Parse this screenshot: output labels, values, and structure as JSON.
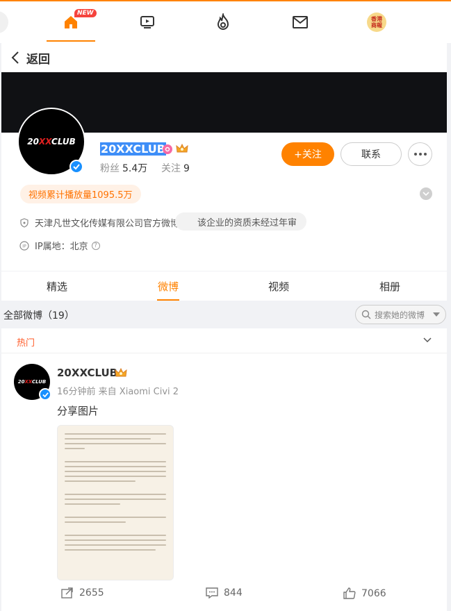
{
  "topnav": {
    "new_badge": "NEW",
    "avatar_text": "香港\n商報",
    "icons": [
      "home-icon",
      "video-icon",
      "fire-icon",
      "mail-icon",
      "avatar"
    ]
  },
  "backbar": {
    "label": "返回"
  },
  "profile": {
    "name": "20XXCLUB",
    "followers_label": "粉丝",
    "followers": "5.4万",
    "following_label": "关注",
    "following": "9",
    "follow_button": "+关注",
    "contact_button": "联系",
    "play_count": "视频累计播放量1095.5万",
    "company": "天津凡世文化传媒有限公司官方微博",
    "qualification": "该企业的资质未经过年审",
    "ip_location": "IP属地：北京"
  },
  "tabs": [
    "精选",
    "微博",
    "视频",
    "相册"
  ],
  "active_tab": "微博",
  "list": {
    "title": "全部微博（19）",
    "search_placeholder": "搜索她的微博"
  },
  "hot": {
    "label": "热门"
  },
  "post": {
    "author": "20XXCLUB",
    "meta": "16分钟前 来自 Xiaomi Civi 2",
    "text": "分享图片",
    "reposts": "2655",
    "comments": "844",
    "likes": "7066"
  },
  "colors": {
    "accent": "#ff8200",
    "cover": "#101114",
    "verified": "#1890ff"
  }
}
